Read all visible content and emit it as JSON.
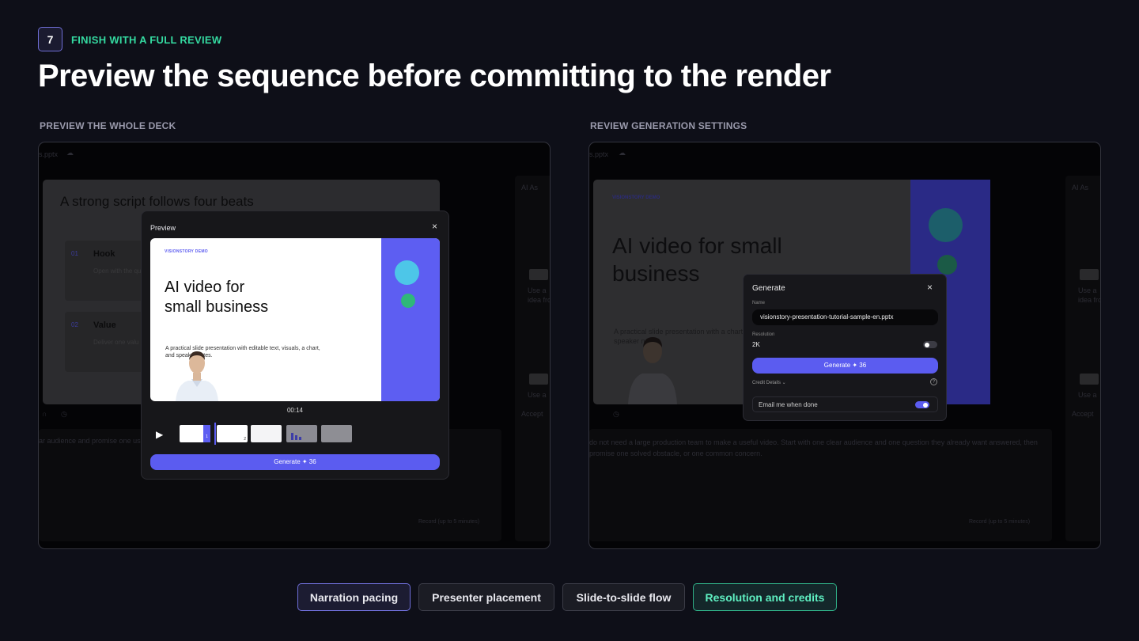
{
  "step_number": "7",
  "eyebrow": "FINISH WITH A FULL REVIEW",
  "headline": "Preview the sequence before committing to the render",
  "left_section_label": "PREVIEW THE WHOLE DECK",
  "right_section_label": "REVIEW GENERATION SETTINGS",
  "left_panel": {
    "file_name": "s.pptx",
    "slide_title": "A strong script follows four beats",
    "beats": [
      {
        "num": "01",
        "label": "Hook",
        "desc": "Open with the qu"
      },
      {
        "num": "02",
        "label": "Value",
        "desc": "Deliver one valu"
      }
    ],
    "side_text": [
      "AI As",
      "Use a",
      "idea fro",
      "Use a",
      "Accept"
    ],
    "script_text": "ar audience and promise one use",
    "record_hint": "Record (up to 5 minutes)",
    "preview_modal": {
      "title": "Preview",
      "close": "×",
      "slide_brand": "VISIONSTORY DEMO",
      "slide_title_line1": "AI video for",
      "slide_title_line2": "small business",
      "slide_subtitle": "A practical slide presentation with editable text, visuals, a chart, and speaker notes.",
      "timestamp": "00:14",
      "play": "▶",
      "thumb_badges": [
        "1",
        "2"
      ],
      "generate_label": "Generate ✦ 36"
    }
  },
  "right_panel": {
    "file_name": "s.pptx",
    "slide_brand": "VISIONSTORY DEMO",
    "slide_title": "AI video for small business",
    "slide_subtitle": "A practical slide presentation with a chart, and speaker notes.",
    "side_text": [
      "AI As",
      "Use a",
      "idea fro",
      "Use a",
      "Accept"
    ],
    "script_text": "do not need a large production team to make a useful video. Start with one clear audience and one question they already want answered, then promise one solved obstacle, or one common concern.",
    "record_hint": "Record (up to 5 minutes)",
    "generate_dialog": {
      "title": "Generate",
      "close": "×",
      "name_label": "Name",
      "name_value": "visionstory-presentation-tutorial-sample-en.pptx",
      "resolution_label": "Resolution",
      "resolution_value": "2K",
      "resolution_toggle_on": false,
      "generate_label": "Generate ✦ 36",
      "credit_details": "Credit Details ⌄",
      "help_icon": "?",
      "email_label": "Email me when done",
      "email_toggle_on": true
    }
  },
  "pills": [
    "Narration pacing",
    "Presenter placement",
    "Slide-to-slide flow",
    "Resolution and credits"
  ],
  "colors": {
    "accent": "#5b5cf0",
    "green": "#34d9a0",
    "background": "#0e0f18"
  }
}
